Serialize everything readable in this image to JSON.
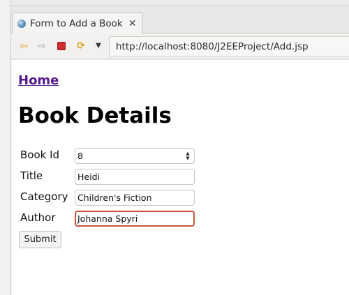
{
  "tab": {
    "title": "Form to Add a Book",
    "close_glyph": "✕"
  },
  "toolbar": {
    "back_icon": "arrow-left-icon",
    "forward_icon": "arrow-right-icon",
    "stop_icon": "stop-icon",
    "refresh_icon": "refresh-icon",
    "url": "http://localhost:8080/J2EEProject/Add.jsp"
  },
  "page": {
    "home_link": "Home",
    "title": "Book Details",
    "form": {
      "book_id": {
        "label": "Book Id",
        "value": "8"
      },
      "title": {
        "label": "Title",
        "value": "Heidi"
      },
      "category": {
        "label": "Category",
        "value": "Children's Fiction"
      },
      "author": {
        "label": "Author",
        "value": "Johanna Spyri"
      },
      "submit_label": "Submit"
    }
  },
  "colors": {
    "link_visited": "#551a8b",
    "focus_ring": "#c8553d",
    "stop_red": "#d22c2c"
  }
}
